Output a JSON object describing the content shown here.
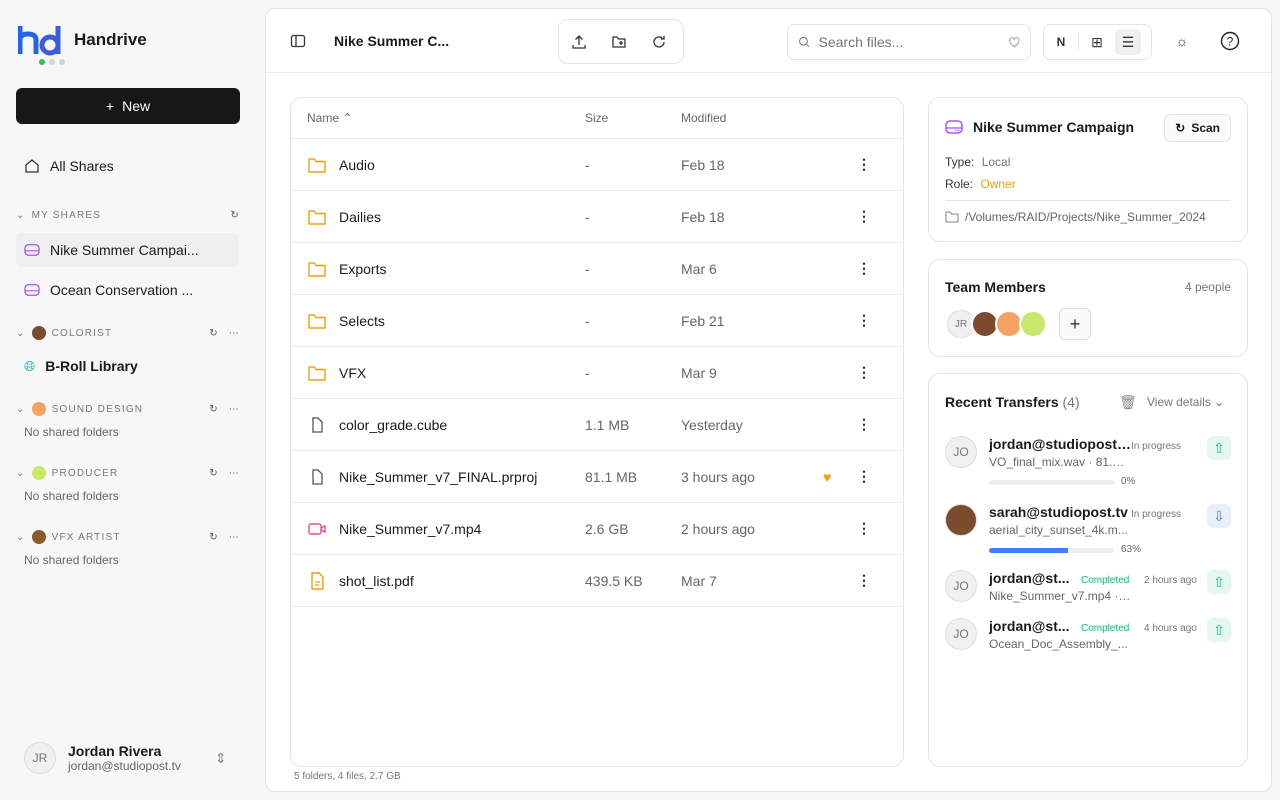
{
  "app": {
    "name": "Handrive"
  },
  "sidebar": {
    "new_label": "New",
    "all_shares": "All Shares",
    "my_shares_header": "MY SHARES",
    "my_shares": [
      {
        "label": "Nike Summer Campai...",
        "active": true
      },
      {
        "label": "Ocean Conservation ..."
      }
    ],
    "groups": [
      {
        "header": "COLORIST",
        "items": [
          "B-Roll Library"
        ],
        "empty": null
      },
      {
        "header": "SOUND DESIGN",
        "items": [],
        "empty": "No shared folders"
      },
      {
        "header": "PRODUCER",
        "items": [],
        "empty": "No shared folders"
      },
      {
        "header": "VFX ARTIST",
        "items": [],
        "empty": "No shared folders"
      }
    ],
    "user": {
      "initials": "JR",
      "name": "Jordan Rivera",
      "email": "jordan@studiopost.tv"
    }
  },
  "header": {
    "title": "Nike Summer C...",
    "search_placeholder": "Search files...",
    "sort_letter": "N"
  },
  "files": {
    "columns": {
      "name": "Name",
      "size": "Size",
      "modified": "Modified"
    },
    "rows": [
      {
        "name": "Audio",
        "type": "folder",
        "size": "-",
        "modified": "Feb 18"
      },
      {
        "name": "Dailies",
        "type": "folder",
        "size": "-",
        "modified": "Feb 18"
      },
      {
        "name": "Exports",
        "type": "folder",
        "size": "-",
        "modified": "Mar 6"
      },
      {
        "name": "Selects",
        "type": "folder",
        "size": "-",
        "modified": "Feb 21"
      },
      {
        "name": "VFX",
        "type": "folder",
        "size": "-",
        "modified": "Mar 9"
      },
      {
        "name": "color_grade.cube",
        "type": "file",
        "size": "1.1 MB",
        "modified": "Yesterday"
      },
      {
        "name": "Nike_Summer_v7_FINAL.prproj",
        "type": "file",
        "size": "81.1 MB",
        "modified": "3 hours ago",
        "favorite": true
      },
      {
        "name": "Nike_Summer_v7.mp4",
        "type": "video",
        "size": "2.6 GB",
        "modified": "2 hours ago"
      },
      {
        "name": "shot_list.pdf",
        "type": "pdf",
        "size": "439.5 KB",
        "modified": "Mar 7"
      }
    ],
    "summary": "5 folders, 4 files, 2.7 GB"
  },
  "details": {
    "title": "Nike Summer Campaign",
    "scan_label": "Scan",
    "type_label": "Type:",
    "type_value": "Local",
    "role_label": "Role:",
    "role_value": "Owner",
    "path": "/Volumes/RAID/Projects/Nike_Summer_2024"
  },
  "team": {
    "title": "Team Members",
    "count": "4 people",
    "first_initials": "JR"
  },
  "transfers": {
    "title": "Recent Transfers",
    "count": "(4)",
    "view_details": "View details",
    "items": [
      {
        "initials": "JO",
        "who": "jordan@studiopost.tv",
        "file": "VO_final_mix.wav · 81.1 ...",
        "status": "In progress",
        "direction": "upload",
        "progress": 0,
        "progress_label": "0%"
      },
      {
        "initials": "",
        "who": "sarah@studiopost.tv",
        "file": "aerial_city_sunset_4k.m...",
        "status": "In progress",
        "direction": "download",
        "progress": 63,
        "progress_label": "63%"
      },
      {
        "initials": "JO",
        "who": "jordan@st...",
        "file": "Nike_Summer_v7.mp4 · ...",
        "status": "Completed",
        "time": "2 hours ago",
        "direction": "upload"
      },
      {
        "initials": "JO",
        "who": "jordan@st...",
        "file": "Ocean_Doc_Assembly_...",
        "status": "Completed",
        "time": "4 hours ago",
        "direction": "upload"
      }
    ]
  },
  "colors": {
    "accent": "#171717",
    "folder": "#f59e0b",
    "share": "#a855f7",
    "completed": "#10b981",
    "progress": "#3b82f6",
    "owner": "#f59e0b"
  }
}
